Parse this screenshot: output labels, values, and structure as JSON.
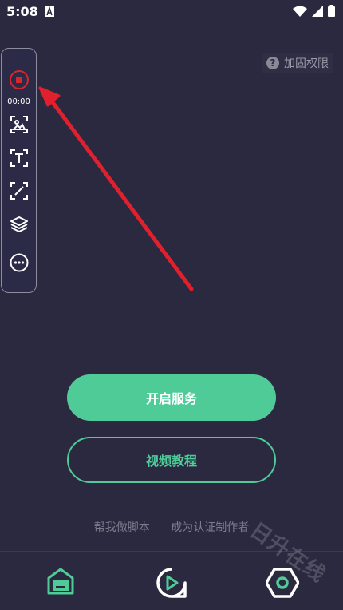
{
  "status_bar": {
    "time": "5:08"
  },
  "permission": {
    "label": "加固权限"
  },
  "float_toolbar": {
    "record_time": "00:00",
    "icons": [
      "record-stop-icon",
      "image-recognition-icon",
      "text-recognition-icon",
      "edit-region-icon",
      "layers-icon",
      "more-icon"
    ]
  },
  "main": {
    "start_service_label": "开启服务",
    "video_tutorial_label": "视频教程",
    "help_script_label": "帮我做脚本",
    "become_author_label": "成为认证制作者"
  },
  "bottom_nav": {
    "tabs": [
      "home-tab-icon",
      "play-tab-icon",
      "settings-tab-icon"
    ]
  },
  "watermark": {
    "text": "日升在线"
  },
  "colors": {
    "background": "#2a2940",
    "accent": "#4fcb98",
    "record_red": "#d8262f",
    "arrow_red": "#e0202c"
  }
}
